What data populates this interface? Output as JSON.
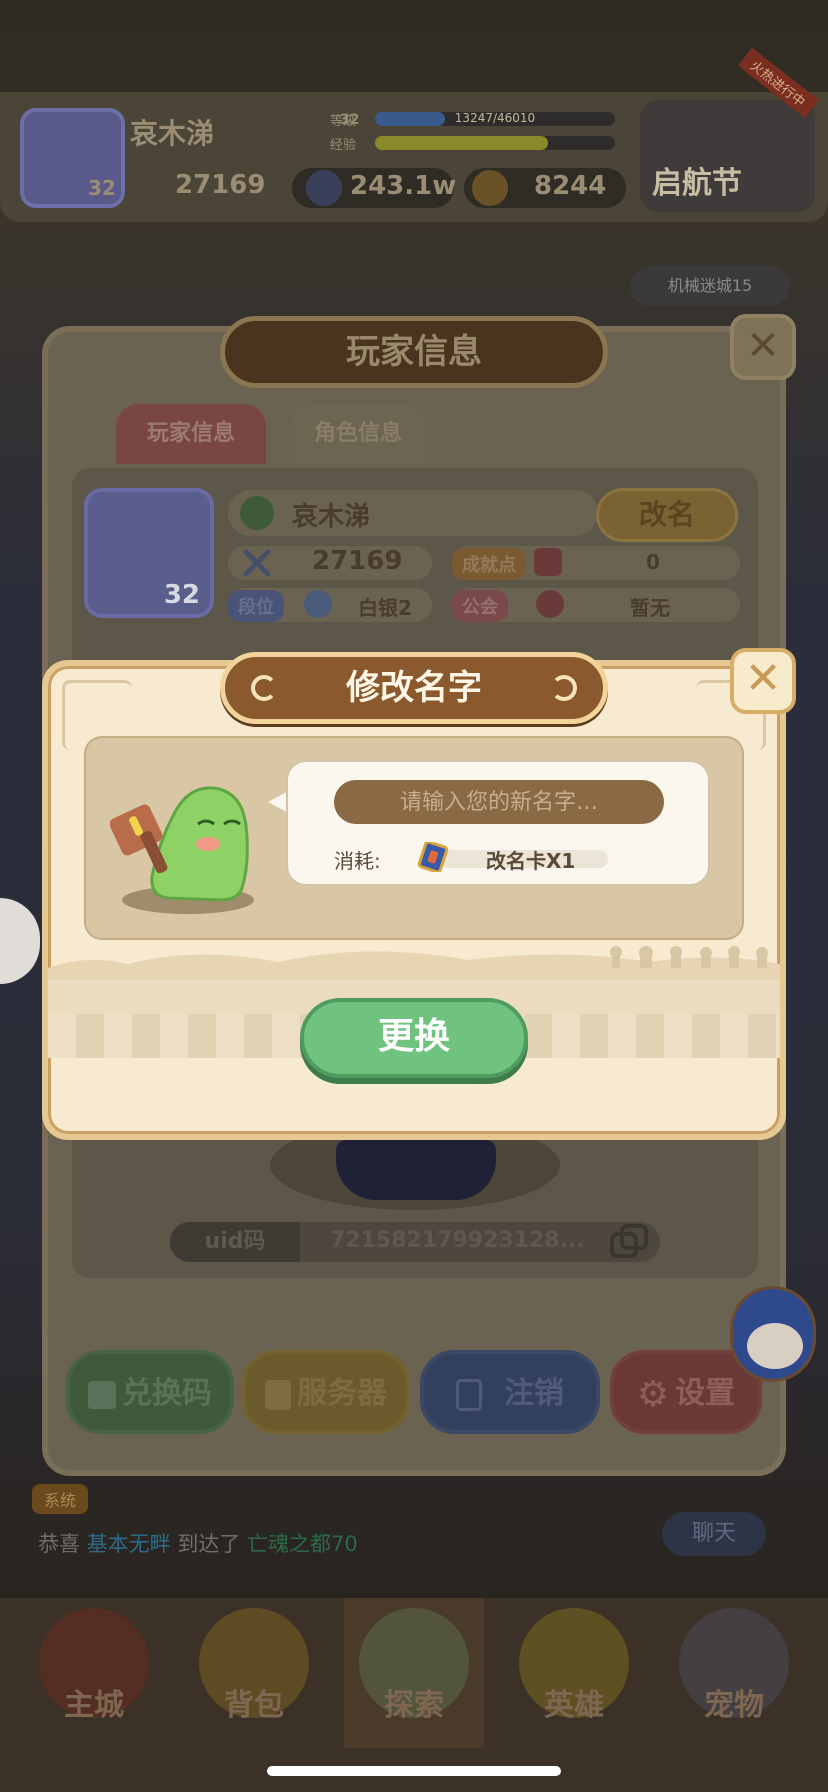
{
  "background": {
    "player": {
      "name": "哀木涕",
      "level": "32",
      "power": "27169"
    },
    "level_label": "等级",
    "exp_label": "经验",
    "exp_text": "13247/46010",
    "currency": {
      "coins": "243.1w",
      "gems": "8244"
    },
    "event": {
      "label": "启航节",
      "ribbon": "火热进行中"
    },
    "top_right_pill": "机械迷城15",
    "chat": {
      "tag": "系统",
      "message_prefix": "恭喜",
      "player": "基本无畔",
      "message_mid": "到达了",
      "place": "亡魂之都70",
      "chat_button": "聊天"
    },
    "nav": [
      {
        "label": "主城"
      },
      {
        "label": "背包"
      },
      {
        "label": "探索"
      },
      {
        "label": "英雄"
      },
      {
        "label": "宠物"
      }
    ]
  },
  "player_info_dialog": {
    "title": "玩家信息",
    "tabs": [
      {
        "label": "玩家信息"
      },
      {
        "label": "角色信息"
      }
    ],
    "name": "哀木涕",
    "level": "32",
    "rename_button": "改名",
    "power": "27169",
    "achievement_label": "成就点",
    "achievement_value": "0",
    "rank_label": "段位",
    "rank_value": "白银2",
    "guild_label": "公会",
    "guild_value": "暂无",
    "uid_label": "uid码",
    "uid_value": "721582179923128...",
    "buttons": {
      "redeem": "兑换码",
      "server": "服务器",
      "logout": "注销",
      "settings": "设置"
    }
  },
  "rename_dialog": {
    "title": "修改名字",
    "input_placeholder": "请输入您的新名字…",
    "cost_label": "消耗:",
    "cost_value": "改名卡X1",
    "submit_button": "更换"
  },
  "colors": {
    "accent_green": "#6fc37f",
    "title_brown": "#8a5a2e",
    "panel_cream": "#f7ead0"
  }
}
